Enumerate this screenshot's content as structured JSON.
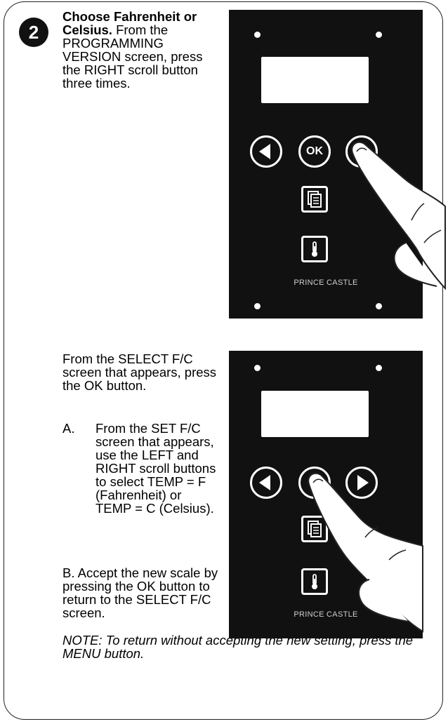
{
  "step": {
    "number": "2",
    "title_bold": "Choose Fahrenheit or Celsius.",
    "title_rest": " From the PROGRAMMING VERSION screen, press the RIGHT scroll button three times."
  },
  "select_fc": {
    "text": "From the SELECT F/C screen that appears, press the OK button."
  },
  "items": [
    {
      "letter": "A.",
      "text": "From the SET F/C screen that appears, use the LEFT and RIGHT scroll buttons to select TEMP = F (Fahrenheit) or TEMP = C (Celsius)."
    },
    {
      "letter": "B.",
      "text": "Accept the new scale by pressing the OK button to return to the SELECT F/C screen."
    }
  ],
  "note": "NOTE: To return without accepting the new setting, press the MENU button.",
  "panel": {
    "brand": "PRINCE CASTLE",
    "ok_label": "OK"
  },
  "icons": [
    "left-arrow-icon",
    "right-arrow-icon",
    "menu-icon",
    "thermometer-icon",
    "pointing-hand-icon"
  ],
  "colors": {
    "panel": "#111111",
    "text": "#000000",
    "brand_text": "#cfcfcf"
  }
}
